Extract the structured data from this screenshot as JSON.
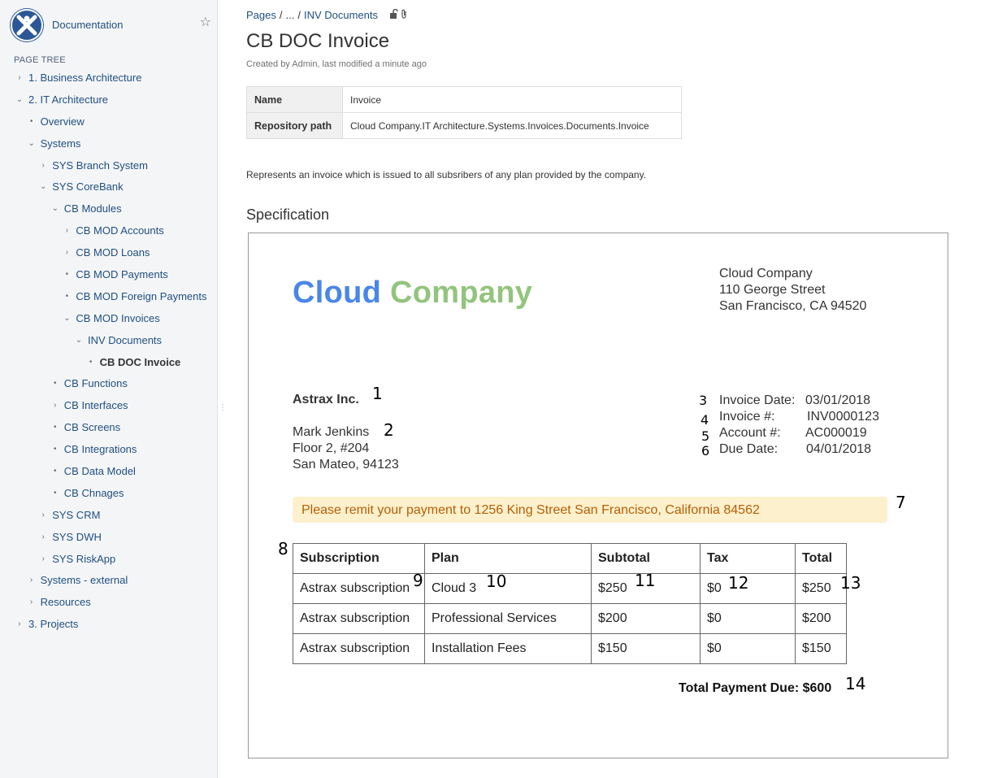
{
  "sidebar": {
    "space_name": "Documentation",
    "page_tree_title": "PAGE TREE",
    "items": [
      {
        "label": "1. Business Architecture",
        "toggle": "›"
      },
      {
        "label": "2. IT Architecture",
        "toggle": "⌄"
      },
      {
        "label": "Overview",
        "toggle": "•"
      },
      {
        "label": "Systems",
        "toggle": "⌄"
      },
      {
        "label": "SYS Branch System",
        "toggle": "›"
      },
      {
        "label": "SYS CoreBank",
        "toggle": "⌄"
      },
      {
        "label": "CB Modules",
        "toggle": "⌄"
      },
      {
        "label": "CB MOD Accounts",
        "toggle": "›"
      },
      {
        "label": "CB MOD Loans",
        "toggle": "›"
      },
      {
        "label": "CB MOD Payments",
        "toggle": "•"
      },
      {
        "label": "CB MOD Foreign Payments",
        "toggle": "•"
      },
      {
        "label": "CB MOD Invoices",
        "toggle": "⌄"
      },
      {
        "label": "INV Documents",
        "toggle": "⌄"
      },
      {
        "label": "CB DOC Invoice",
        "toggle": "•"
      },
      {
        "label": "CB Functions",
        "toggle": "•"
      },
      {
        "label": "CB Interfaces",
        "toggle": "›"
      },
      {
        "label": "CB Screens",
        "toggle": "•"
      },
      {
        "label": "CB Integrations",
        "toggle": "•"
      },
      {
        "label": "CB Data Model",
        "toggle": "•"
      },
      {
        "label": "CB Chnages",
        "toggle": "•"
      },
      {
        "label": "SYS CRM",
        "toggle": "›"
      },
      {
        "label": "SYS DWH",
        "toggle": "›"
      },
      {
        "label": "SYS RiskApp",
        "toggle": "›"
      },
      {
        "label": "Systems - external",
        "toggle": "›"
      },
      {
        "label": "Resources",
        "toggle": "›"
      },
      {
        "label": "3. Projects",
        "toggle": "›"
      }
    ]
  },
  "breadcrumb": {
    "root": "Pages",
    "sep1": "/",
    "ellipsis": "...",
    "sep2": "/",
    "parent": "INV Documents"
  },
  "page": {
    "title": "CB DOC Invoice",
    "byline": "Created by Admin, last modified a minute ago",
    "properties": [
      {
        "key": "Name",
        "value": "Invoice"
      },
      {
        "key": "Repository path",
        "value": "Cloud Company.IT Architecture.Systems.Invoices.Documents.Invoice"
      }
    ],
    "description": "Represents an invoice which is issued to all subsribers of any plan provided by the company.",
    "spec_heading": "Specification"
  },
  "invoice": {
    "logo_word1": "Cloud",
    "logo_word2": "Company",
    "company_lines": [
      "Cloud Company",
      "110 George Street",
      "San Francisco, CA 94520"
    ],
    "customer": "Astrax Inc.",
    "contact_lines": [
      "Mark Jenkins",
      "Floor 2, #204",
      "San Mateo, 94123"
    ],
    "meta": [
      {
        "label": "Invoice Date:",
        "value": "03/01/2018"
      },
      {
        "label": "Invoice #:",
        "value": "INV0000123"
      },
      {
        "label": "Account #:",
        "value": "AC000019"
      },
      {
        "label": "Due Date:",
        "value": "04/01/2018"
      }
    ],
    "banner": "Please remit your payment to 1256 King Street San Francisco, California 84562",
    "table": {
      "headers": [
        "Subscription",
        "Plan",
        "Subtotal",
        "Tax",
        "Total"
      ],
      "rows": [
        [
          "Astrax subscription",
          "Cloud 3",
          "$250",
          "$0",
          "$250"
        ],
        [
          "Astrax subscription",
          "Professional Services",
          "$200",
          "$0",
          "$200"
        ],
        [
          "Astrax subscription",
          "Installation Fees",
          "$150",
          "$0",
          "$150"
        ]
      ]
    },
    "total_line": "Total Payment Due: $600"
  },
  "annotations": [
    "1",
    "2",
    "3",
    "4",
    "5",
    "6",
    "7",
    "8",
    "9",
    "10",
    "11",
    "12",
    "13",
    "14"
  ]
}
